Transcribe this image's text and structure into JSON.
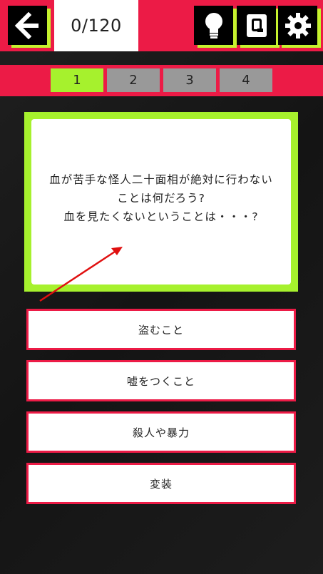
{
  "header": {
    "score": "0/120"
  },
  "tabs": [
    {
      "label": "1",
      "active": true
    },
    {
      "label": "2",
      "active": false
    },
    {
      "label": "3",
      "active": false
    },
    {
      "label": "4",
      "active": false
    }
  ],
  "question": {
    "text": "血が苦手な怪人二十面相が絶対に行わない\nことは何だろう?\n血を見たくないということは・・・?"
  },
  "answers": [
    {
      "label": "盗むこと"
    },
    {
      "label": "嘘をつくこと"
    },
    {
      "label": "殺人や暴力"
    },
    {
      "label": "変装"
    }
  ],
  "colors": {
    "accent_red": "#ec1b46",
    "accent_green": "#a6f12d",
    "tab_inactive": "#999999"
  },
  "icons": {
    "back": "back-arrow-icon",
    "hint": "lightbulb-icon",
    "q": "q-icon",
    "settings": "gear-icon"
  }
}
